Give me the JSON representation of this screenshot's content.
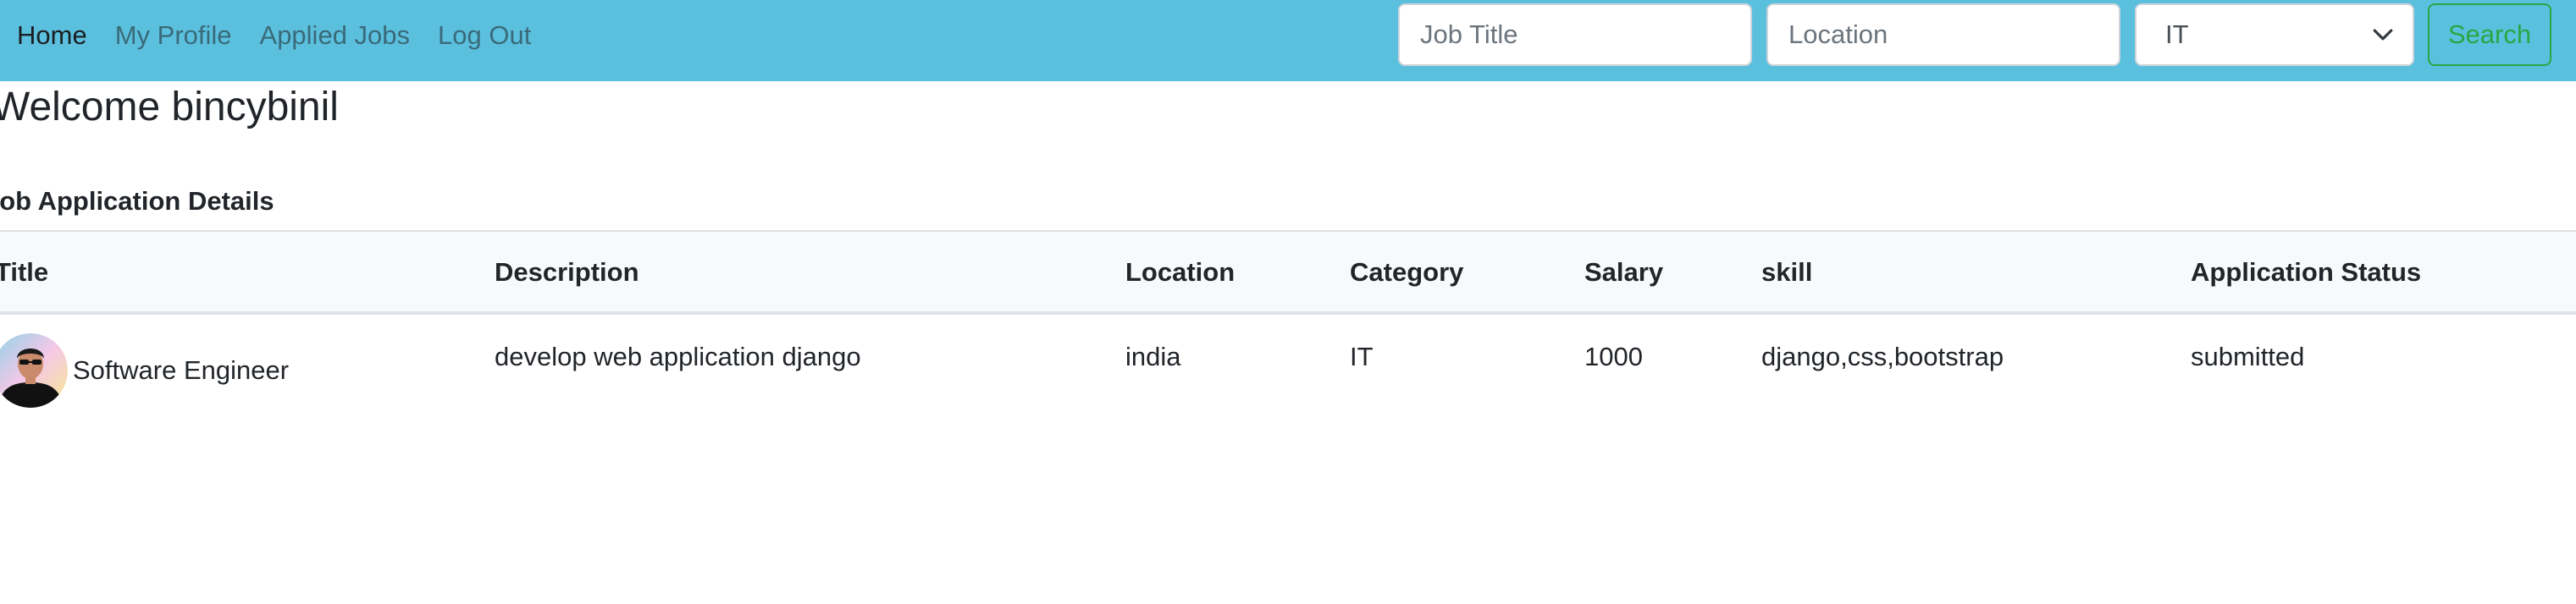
{
  "navbar": {
    "links": [
      "Home",
      "My Profile",
      "Applied Jobs",
      "Log Out"
    ],
    "active": "Home",
    "search": {
      "title_placeholder": "Job Title",
      "location_placeholder": "Location",
      "category_selected": "IT",
      "button_label": "Search"
    },
    "colors": {
      "background": "#5bc0de",
      "search_button": "#28a745"
    }
  },
  "welcome": "Welcome bincybinil",
  "section_title": "Job Application Details",
  "table": {
    "columns": [
      "Title",
      "Description",
      "Location",
      "Category",
      "Salary",
      "skill",
      "Application Status"
    ],
    "rows": [
      {
        "title": "Software Engineer",
        "description": "develop web application django",
        "location": "india",
        "category": "IT",
        "salary": "1000",
        "skill": "django,css,bootstrap",
        "status": "submitted"
      }
    ]
  }
}
